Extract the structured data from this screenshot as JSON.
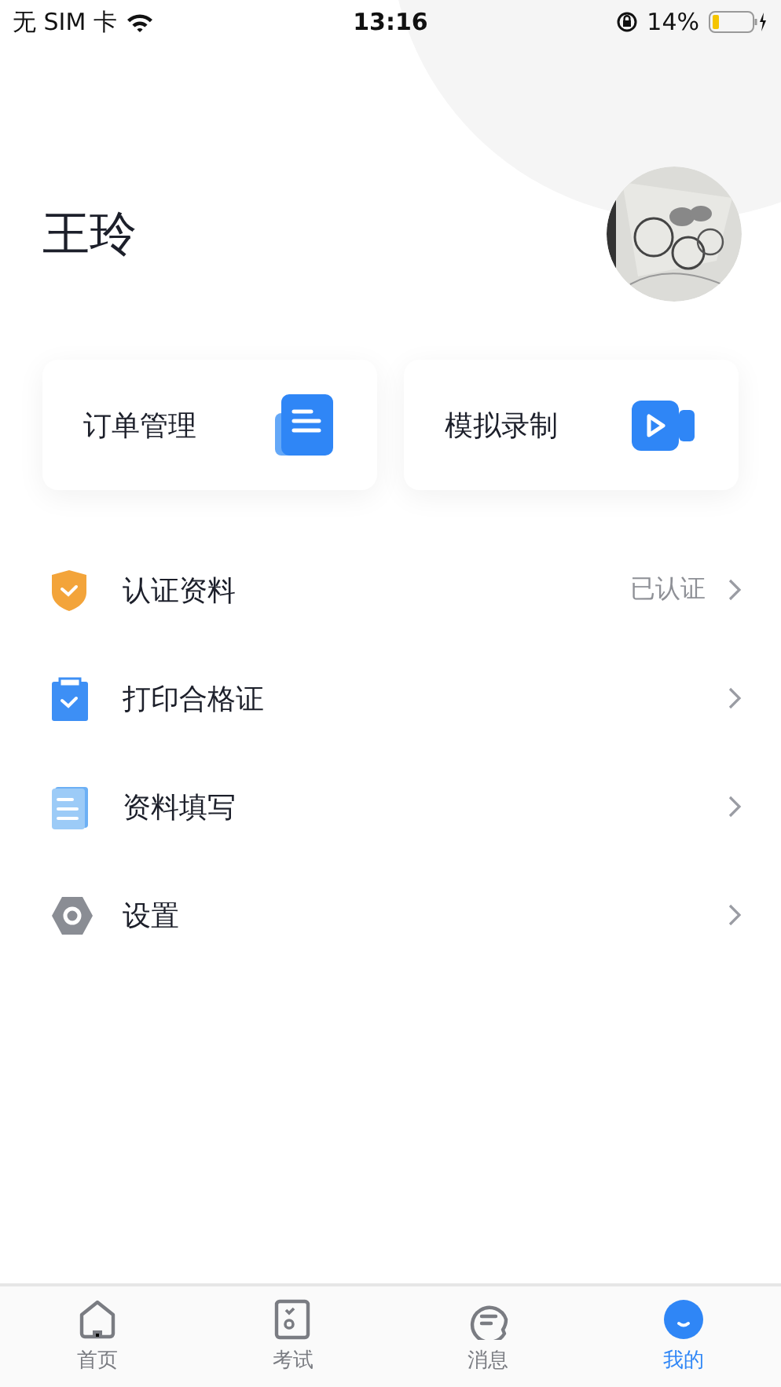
{
  "status_bar": {
    "carrier": "无 SIM 卡",
    "time": "13:16",
    "battery": "14%"
  },
  "profile": {
    "name": "王玲"
  },
  "shortcuts": [
    {
      "label": "订单管理",
      "kind": "document"
    },
    {
      "label": "模拟录制",
      "kind": "video"
    }
  ],
  "menu": [
    {
      "label": "认证资料",
      "kind": "shield",
      "status": "已认证"
    },
    {
      "label": "打印合格证",
      "kind": "clipboard"
    },
    {
      "label": "资料填写",
      "kind": "form"
    },
    {
      "label": "设置",
      "kind": "gear"
    }
  ],
  "tabs": [
    {
      "label": "首页",
      "kind": "home",
      "selected": false
    },
    {
      "label": "考试",
      "kind": "exam",
      "selected": false
    },
    {
      "label": "消息",
      "kind": "message",
      "selected": false
    },
    {
      "label": "我的",
      "kind": "me",
      "selected": true
    }
  ]
}
